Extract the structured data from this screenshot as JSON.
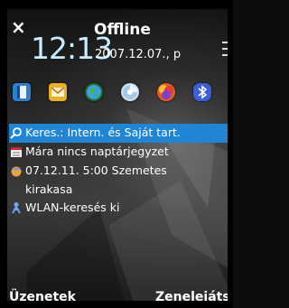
{
  "status": {
    "close_glyph": "×",
    "time": "12:13",
    "profile": "Offline",
    "date": "2007.12.07., p"
  },
  "shortcuts": [
    {
      "name": "contacts-shortcut",
      "icon": "contacts-book-icon",
      "color": "#2f7fd1"
    },
    {
      "name": "messaging-shortcut",
      "icon": "envelope-icon",
      "color": "#e9b024"
    },
    {
      "name": "web-shortcut",
      "icon": "globe-icon",
      "color": "#2f9a45"
    },
    {
      "name": "tools-shortcut",
      "icon": "cd-icon",
      "color": "#9ab6d8"
    },
    {
      "name": "media-shortcut",
      "icon": "media-gallery-icon",
      "color": "#e85d1f"
    },
    {
      "name": "bluetooth-shortcut",
      "icon": "bluetooth-icon",
      "color": "#3a5fd6"
    }
  ],
  "list": {
    "search": "Keres.: Intern. és Saját tart.",
    "calendar": "Mára nincs naptárjegyzet",
    "reminder_line1": "07.12.11. 5:00 Szemetes",
    "reminder_line2": "kirakasa",
    "wlan": "WLAN-keresés ki"
  },
  "softkeys": {
    "left": "Üzenetek",
    "right": "Zenelejátszó"
  }
}
